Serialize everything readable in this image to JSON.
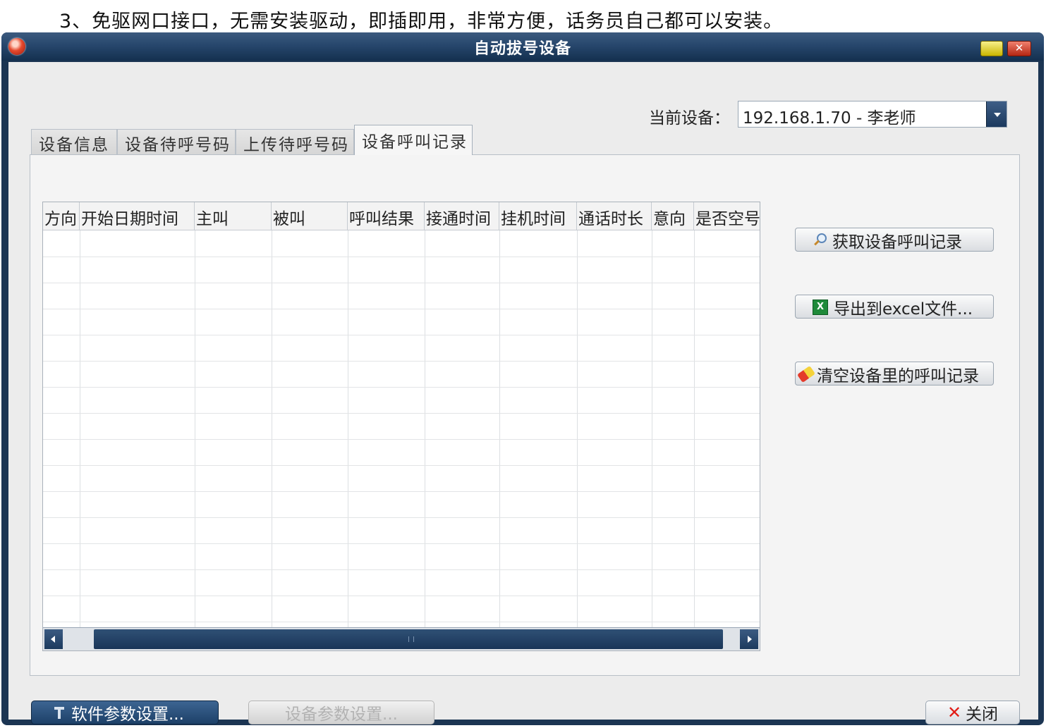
{
  "caption": "3、免驱网口接口，无需安装驱动，即插即用，非常方便，话务员自己都可以安装。",
  "window": {
    "title": "自动拔号设备"
  },
  "device": {
    "label": "当前设备：",
    "value": "192.168.1.70 - 李老师"
  },
  "tabs": [
    {
      "label": "设备信息",
      "active": false
    },
    {
      "label": "设备待呼号码",
      "active": false
    },
    {
      "label": "上传待呼号码",
      "active": false
    },
    {
      "label": "设备呼叫记录",
      "active": true
    }
  ],
  "table": {
    "columns": [
      "方向",
      "开始日期时间",
      "主叫",
      "被叫",
      "呼叫结果",
      "接通时间",
      "挂机时间",
      "通话时长",
      "意向",
      "是否空号"
    ],
    "rows": []
  },
  "actions": {
    "fetch_records": "获取设备呼叫记录",
    "export_excel": "导出到excel文件...",
    "clear_records": "清空设备里的呼叫记录"
  },
  "footer": {
    "software_settings": "软件参数设置...",
    "device_settings": "设备参数设置...",
    "close": "关闭"
  },
  "colors": {
    "title_bar": "#27476d",
    "client_bg": "#ececec",
    "close_x": "#e21c16"
  }
}
